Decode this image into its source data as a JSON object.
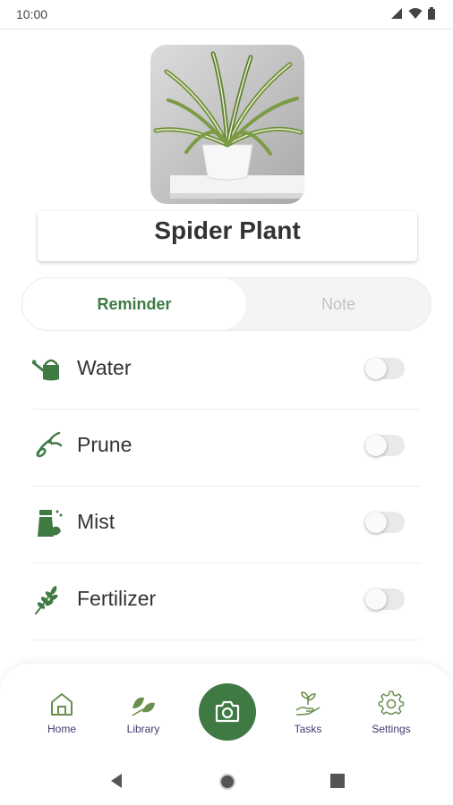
{
  "status_bar": {
    "time": "10:00"
  },
  "plant": {
    "name": "Spider Plant"
  },
  "tabs": [
    {
      "label": "Reminder",
      "active": true
    },
    {
      "label": "Note",
      "active": false
    }
  ],
  "reminders": [
    {
      "label": "Water",
      "icon": "watering-can-icon",
      "enabled": false
    },
    {
      "label": "Prune",
      "icon": "pruning-shears-icon",
      "enabled": false
    },
    {
      "label": "Mist",
      "icon": "spray-bottle-icon",
      "enabled": false
    },
    {
      "label": "Fertilizer",
      "icon": "wheat-icon",
      "enabled": false
    }
  ],
  "bottom_nav": [
    {
      "label": "Home",
      "icon": "home-icon"
    },
    {
      "label": "Library",
      "icon": "leaf-icon"
    },
    {
      "label": "",
      "icon": "camera-icon"
    },
    {
      "label": "Tasks",
      "icon": "plant-hand-icon"
    },
    {
      "label": "Settings",
      "icon": "gear-icon"
    }
  ],
  "colors": {
    "accent": "#3f7a43",
    "nav_label": "#3f3a6e",
    "inactive_tab": "#c2c2c2"
  }
}
